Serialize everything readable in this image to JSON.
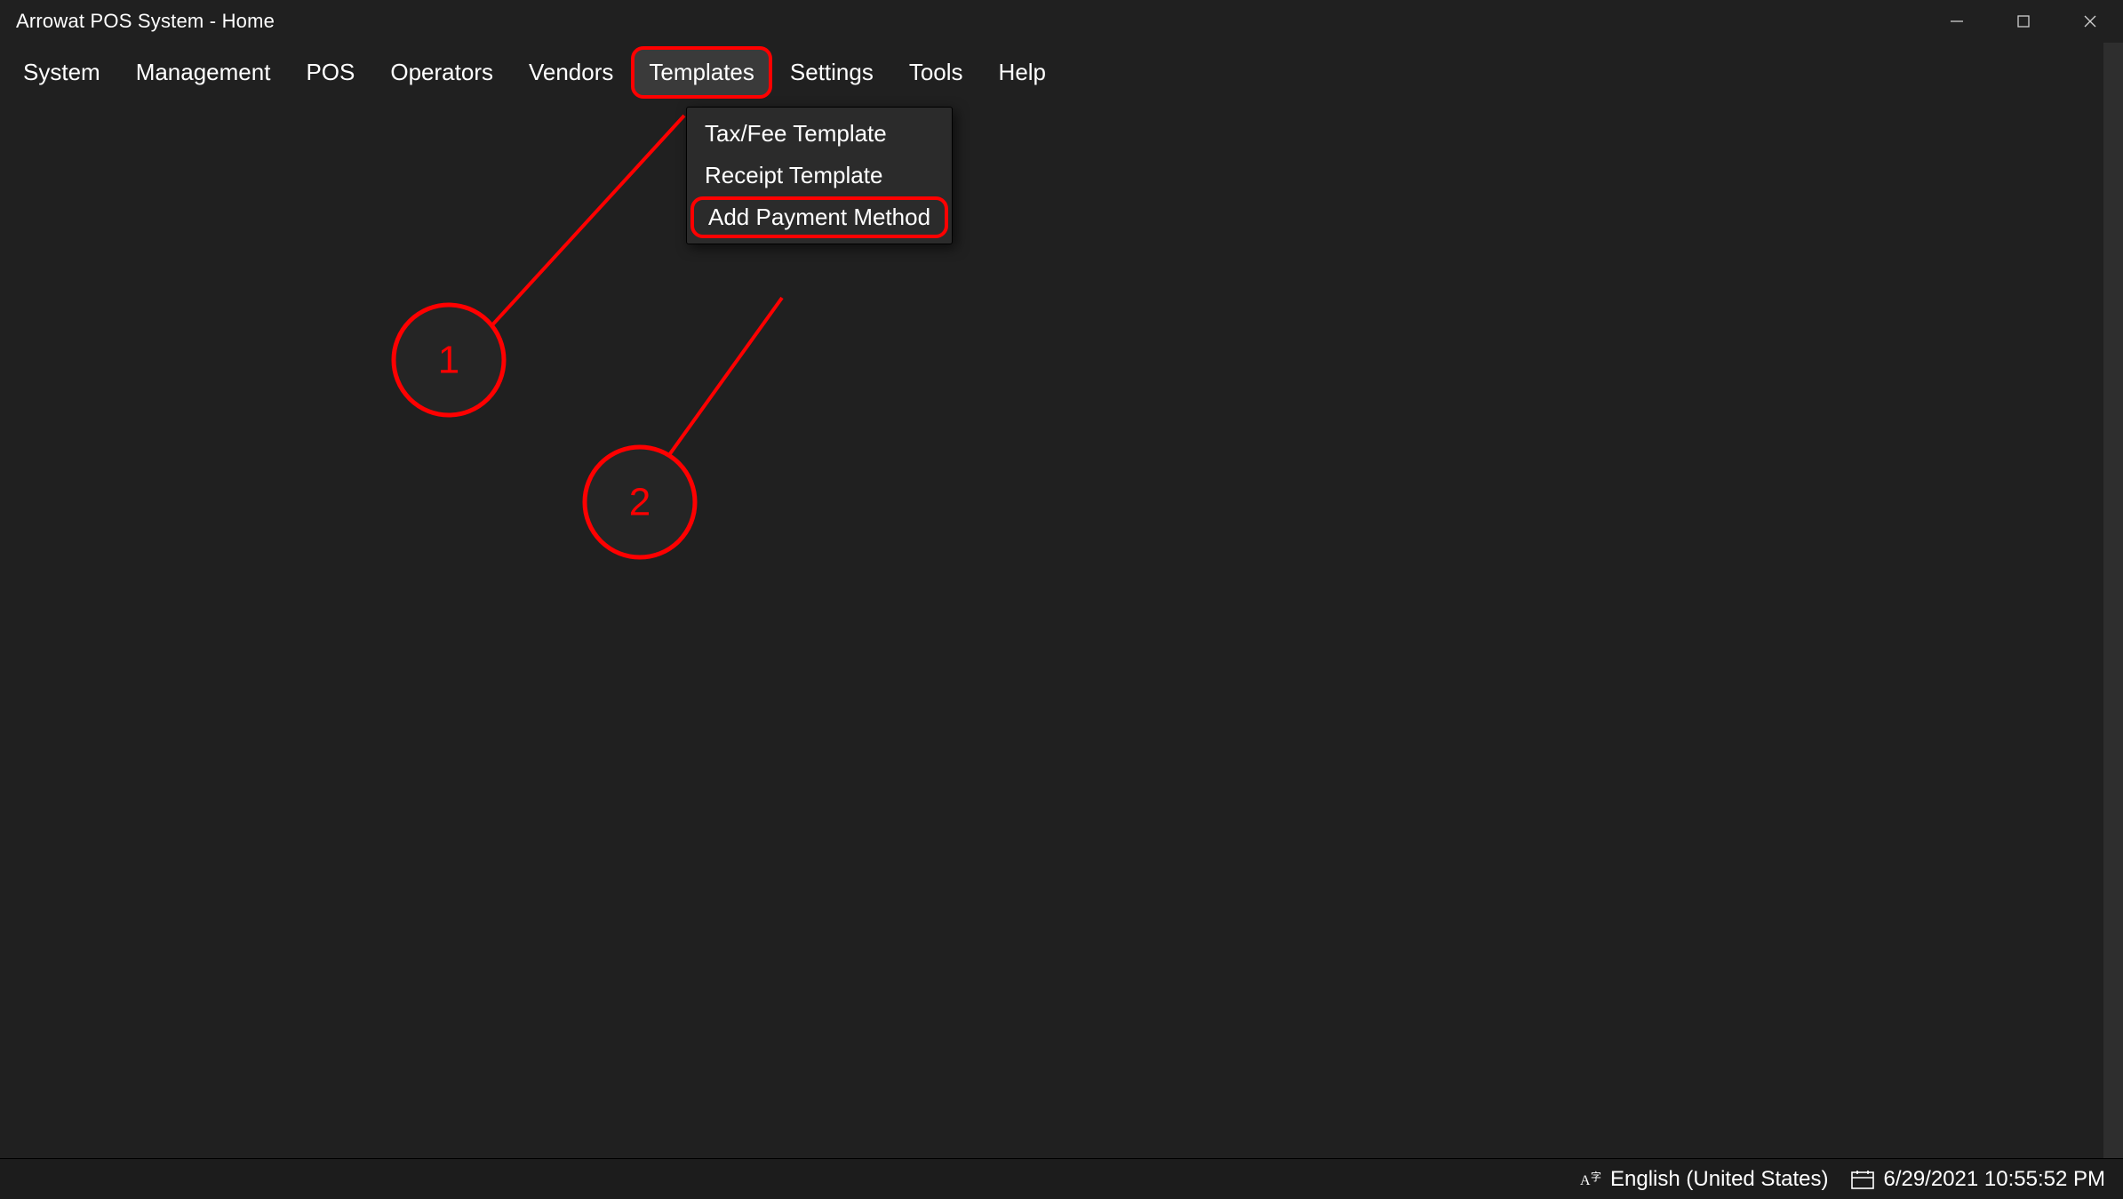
{
  "window": {
    "title": "Arrowat POS System - Home"
  },
  "menu": {
    "items": [
      "System",
      "Management",
      "POS",
      "Operators",
      "Vendors",
      "Templates",
      "Settings",
      "Tools",
      "Help"
    ],
    "active_index": 5
  },
  "dropdown": {
    "items": [
      "Tax/Fee Template",
      "Receipt Template",
      "Add Payment Method"
    ],
    "highlighted_index": 2
  },
  "annotations": {
    "marker1": "1",
    "marker2": "2"
  },
  "status": {
    "language": "English (United States)",
    "datetime": "6/29/2021 10:55:52 PM"
  },
  "colors": {
    "bg": "#202020",
    "dropdown_bg": "#2b2b2b",
    "annotation": "#ff0000",
    "text": "#ffffff"
  }
}
